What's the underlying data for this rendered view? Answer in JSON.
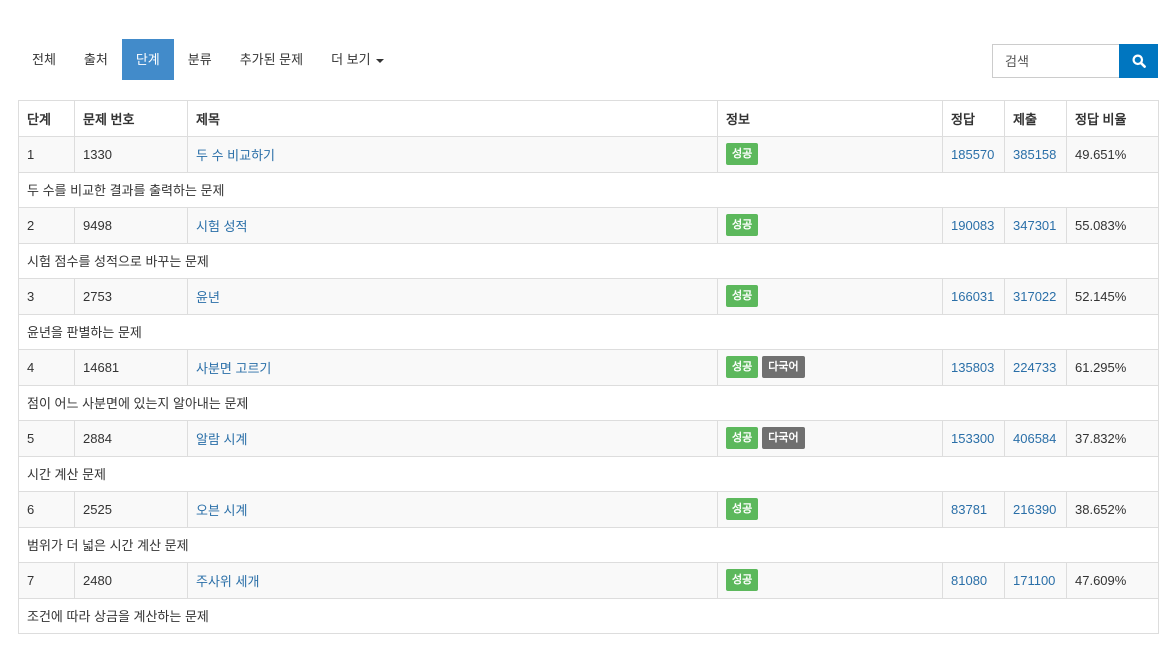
{
  "nav": {
    "items": [
      {
        "label": "전체",
        "active": false
      },
      {
        "label": "출처",
        "active": false
      },
      {
        "label": "단계",
        "active": true
      },
      {
        "label": "분류",
        "active": false
      },
      {
        "label": "추가된 문제",
        "active": false
      },
      {
        "label": "더 보기",
        "active": false,
        "dropdown": true
      }
    ]
  },
  "search": {
    "placeholder": "검색",
    "icon": "search-icon"
  },
  "table": {
    "headers": [
      "단계",
      "문제 번호",
      "제목",
      "정보",
      "정답",
      "제출",
      "정답 비율"
    ],
    "rows": [
      {
        "level": "1",
        "id": "1330",
        "title": "두 수 비교하기",
        "badges": [
          "성공"
        ],
        "correct": "185570",
        "submit": "385158",
        "ratio": "49.651%",
        "description": "두 수를 비교한 결과를 출력하는 문제"
      },
      {
        "level": "2",
        "id": "9498",
        "title": "시험 성적",
        "badges": [
          "성공"
        ],
        "correct": "190083",
        "submit": "347301",
        "ratio": "55.083%",
        "description": "시험 점수를 성적으로 바꾸는 문제"
      },
      {
        "level": "3",
        "id": "2753",
        "title": "윤년",
        "badges": [
          "성공"
        ],
        "correct": "166031",
        "submit": "317022",
        "ratio": "52.145%",
        "description": "윤년을 판별하는 문제"
      },
      {
        "level": "4",
        "id": "14681",
        "title": "사분면 고르기",
        "badges": [
          "성공",
          "다국어"
        ],
        "correct": "135803",
        "submit": "224733",
        "ratio": "61.295%",
        "description": "점이 어느 사분면에 있는지 알아내는 문제"
      },
      {
        "level": "5",
        "id": "2884",
        "title": "알람 시계",
        "badges": [
          "성공",
          "다국어"
        ],
        "correct": "153300",
        "submit": "406584",
        "ratio": "37.832%",
        "description": "시간 계산 문제"
      },
      {
        "level": "6",
        "id": "2525",
        "title": "오븐 시계",
        "badges": [
          "성공"
        ],
        "correct": "83781",
        "submit": "216390",
        "ratio": "38.652%",
        "description": "범위가 더 넓은 시간 계산 문제"
      },
      {
        "level": "7",
        "id": "2480",
        "title": "주사위 세개",
        "badges": [
          "성공"
        ],
        "correct": "81080",
        "submit": "171100",
        "ratio": "47.609%",
        "description": "조건에 따라 상금을 계산하는 문제"
      }
    ]
  },
  "colors": {
    "accent": "#428bca",
    "link": "#2a6fa8",
    "success": "#5cb85c",
    "lang_badge": "#707070",
    "search_button": "#0076c0"
  }
}
